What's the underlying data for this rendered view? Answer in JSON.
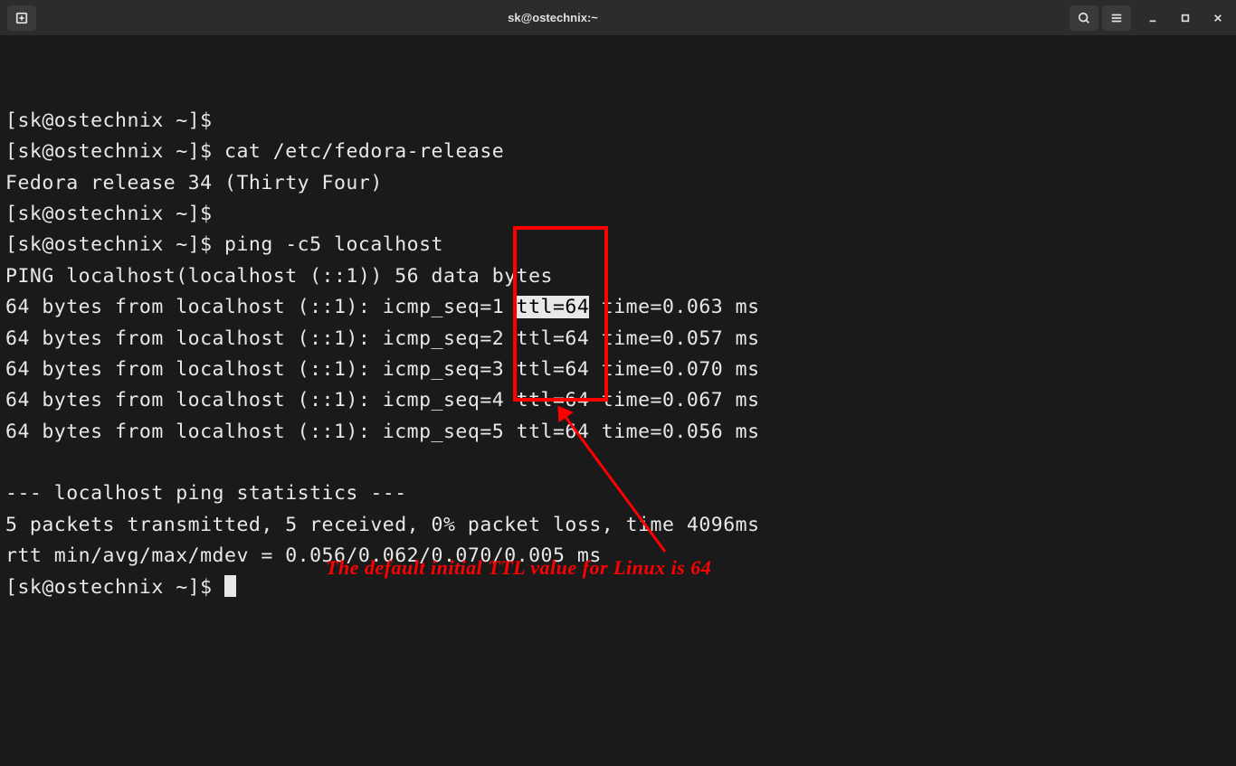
{
  "titlebar": {
    "title": "sk@ostechnix:~"
  },
  "terminal": {
    "prompt": "[sk@ostechnix ~]$",
    "lines": [
      {
        "type": "prompt",
        "cmd": ""
      },
      {
        "type": "prompt",
        "cmd": " cat /etc/fedora-release"
      },
      {
        "type": "output",
        "text": "Fedora release 34 (Thirty Four)"
      },
      {
        "type": "prompt",
        "cmd": ""
      },
      {
        "type": "prompt",
        "cmd": " ping -c5 localhost"
      },
      {
        "type": "output",
        "text": "PING localhost(localhost (::1)) 56 data bytes"
      },
      {
        "type": "ping",
        "prefix": "64 bytes from localhost (::1): icmp_seq=1 ",
        "ttl": "ttl=64",
        "suffix": " time=0.063 ms",
        "highlighted": true
      },
      {
        "type": "ping",
        "prefix": "64 bytes from localhost (::1): icmp_seq=2 ",
        "ttl": "ttl=64",
        "suffix": " time=0.057 ms",
        "highlighted": false
      },
      {
        "type": "ping",
        "prefix": "64 bytes from localhost (::1): icmp_seq=3 ",
        "ttl": "ttl=64",
        "suffix": " time=0.070 ms",
        "highlighted": false
      },
      {
        "type": "ping",
        "prefix": "64 bytes from localhost (::1): icmp_seq=4 ",
        "ttl": "ttl=64",
        "suffix": " time=0.067 ms",
        "highlighted": false
      },
      {
        "type": "ping",
        "prefix": "64 bytes from localhost (::1): icmp_seq=5 ",
        "ttl": "ttl=64",
        "suffix": " time=0.056 ms",
        "highlighted": false
      },
      {
        "type": "output",
        "text": ""
      },
      {
        "type": "output",
        "text": "--- localhost ping statistics ---"
      },
      {
        "type": "output",
        "text": "5 packets transmitted, 5 received, 0% packet loss, time 4096ms"
      },
      {
        "type": "output",
        "text": "rtt min/avg/max/mdev = 0.056/0.062/0.070/0.005 ms"
      },
      {
        "type": "prompt",
        "cmd": " ",
        "cursor": true
      }
    ]
  },
  "annotation": {
    "text": "The default initial TTL value for Linux is 64"
  }
}
